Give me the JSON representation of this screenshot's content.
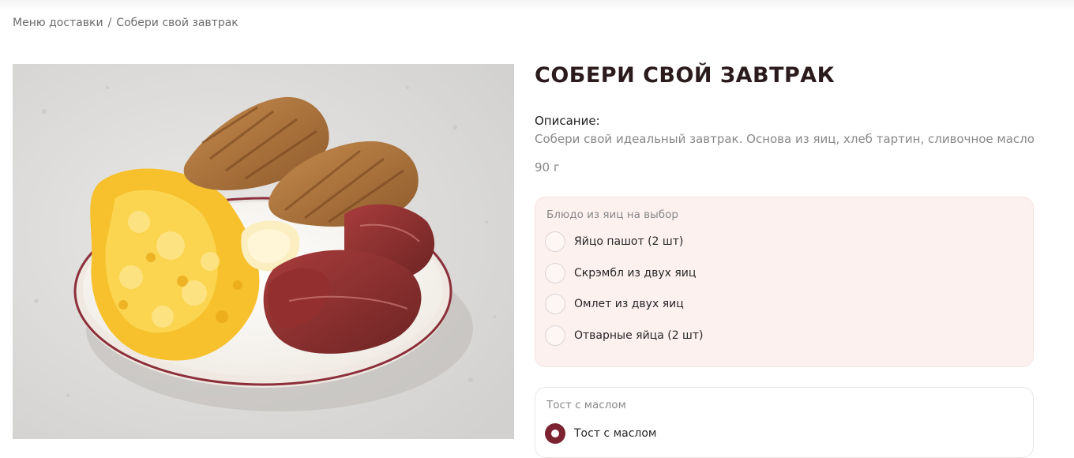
{
  "breadcrumb": {
    "items": [
      "Меню доставки",
      "Собери свой завтрак"
    ],
    "separator": "/"
  },
  "product": {
    "title": "СОБЕРИ СВОЙ ЗАВТРАК",
    "description_label": "Описание:",
    "description": "Собери свой идеальный завтрак. Основа из яиц, хлеб тартин, сливочное масло",
    "weight": "90 г"
  },
  "groups": [
    {
      "title": "Блюдо из яиц на выбор",
      "options": [
        {
          "label": "Яйцо пашот (2 шт)",
          "selected": false
        },
        {
          "label": "Скрэмбл из двух яиц",
          "selected": false
        },
        {
          "label": "Омлет из двух яиц",
          "selected": false
        },
        {
          "label": "Отварные яйца (2 шт)",
          "selected": false
        }
      ]
    },
    {
      "title": "Тост с маслом",
      "options": [
        {
          "label": "Тост с маслом",
          "selected": true
        }
      ]
    }
  ],
  "colors": {
    "accent": "#7c2331",
    "title": "#2b1b1c",
    "group_bg": "#fdf1f0"
  }
}
